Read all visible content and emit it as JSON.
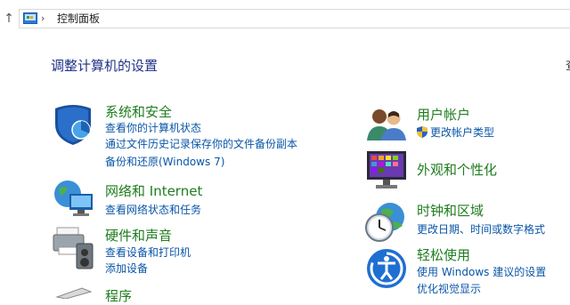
{
  "address": {
    "separator": "›",
    "crumb": "控制面板"
  },
  "page": {
    "title": "调整计算机的设置",
    "viewby_fragment": "查"
  },
  "left_categories": [
    {
      "title": "系统和安全",
      "links": [
        "查看你的计算机状态",
        "通过文件历史记录保存你的文件备份副本",
        "备份和还原(Windows 7)"
      ],
      "icon": "shield-icon"
    },
    {
      "title": "网络和 Internet",
      "links": [
        "查看网络状态和任务"
      ],
      "icon": "network-globe-icon"
    },
    {
      "title": "硬件和声音",
      "links": [
        "查看设备和打印机",
        "添加设备"
      ],
      "icon": "printer-speaker-icon"
    },
    {
      "title": "程序",
      "links": [],
      "icon": "programs-icon"
    }
  ],
  "right_categories": [
    {
      "title": "用户帐户",
      "links": [
        "更改帐户类型"
      ],
      "icon": "users-icon"
    },
    {
      "title": "外观和个性化",
      "links": [],
      "icon": "monitor-appearance-icon"
    },
    {
      "title": "时钟和区域",
      "links": [
        "更改日期、时间或数字格式"
      ],
      "icon": "clock-globe-icon"
    },
    {
      "title": "轻松使用",
      "links": [
        "使用 Windows 建议的设置",
        "优化视觉显示"
      ],
      "icon": "ease-of-access-icon"
    }
  ]
}
